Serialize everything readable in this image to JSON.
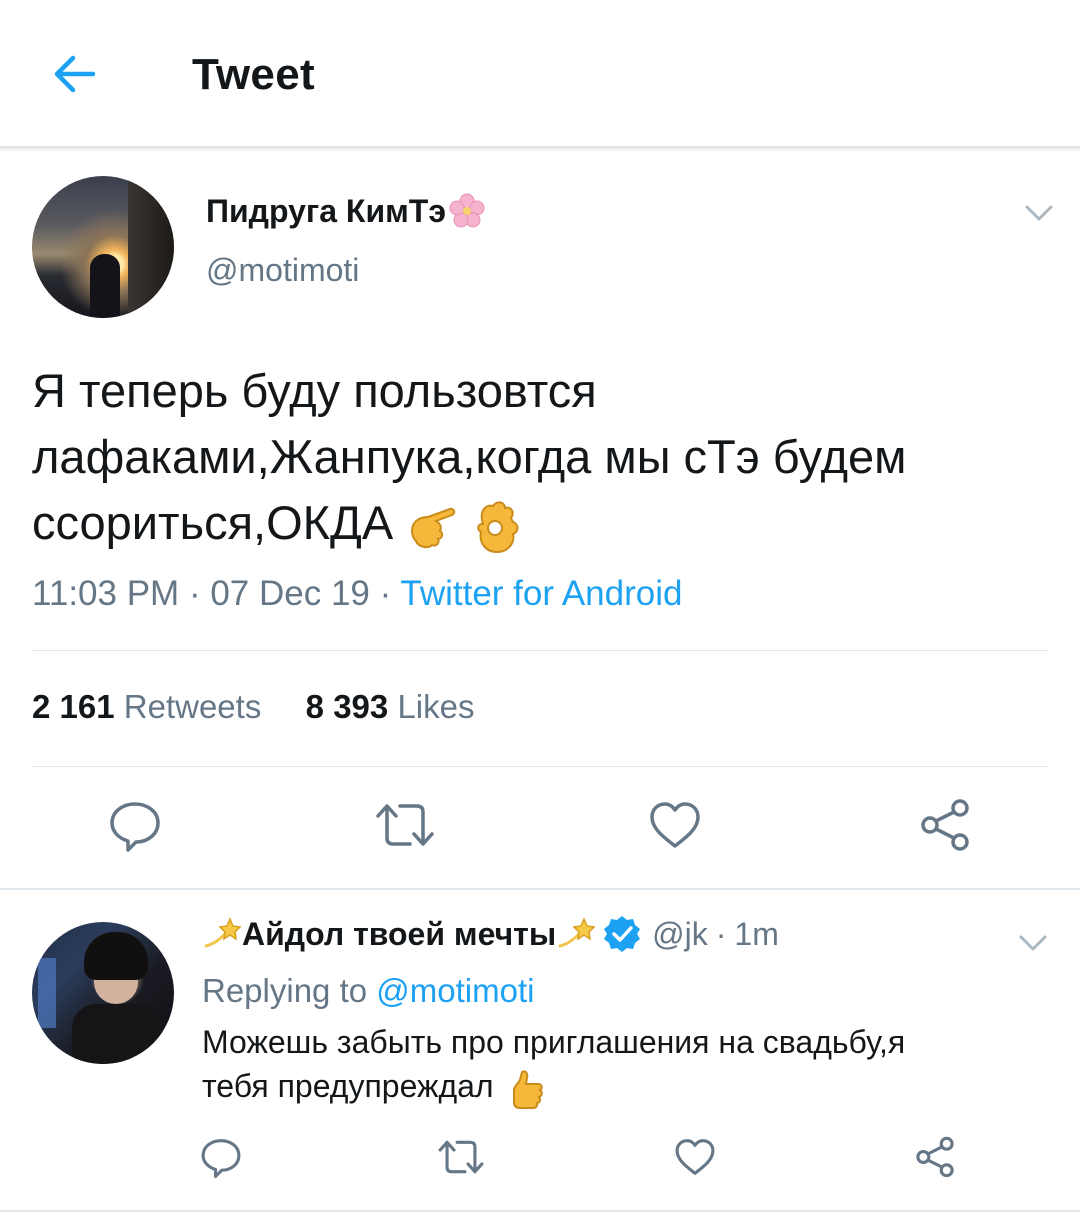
{
  "header": {
    "title": "Tweet",
    "back_icon": "arrow-left-icon",
    "accent": "#1da1f2"
  },
  "tweet": {
    "author_name": "Пидруга КимТэ",
    "author_handle": "@motimoti",
    "author_emoji": "cherry-blossom-icon",
    "text_lines": [
      "Я теперь буду пользовтся",
      "лафаками,Жанпука,когда мы сТэ будем",
      "ссориться,ОКДА"
    ],
    "text_emojis": [
      "pointing-hand-icon",
      "ok-hand-icon"
    ],
    "time": "11:03 PM",
    "date": "07 Dec 19",
    "separator": "·",
    "source": "Twitter for Android",
    "retweets_count": "2 161",
    "retweets_label": "Retweets",
    "likes_count": "8 393",
    "likes_label": "Likes",
    "actions": [
      "reply-icon",
      "retweet-icon",
      "like-icon",
      "share-icon"
    ]
  },
  "reply": {
    "author_name": "Айдол твоей мечты",
    "name_emoji": "dizzy-star-icon",
    "verified_icon": "verified-badge-icon",
    "handle": "@jk",
    "separator": "·",
    "time": "1m",
    "replying_prefix": "Replying to",
    "replying_handle": "@motimoti",
    "text_line1": "Можешь забыть про приглашения на свадьбу,я",
    "text_line2": "тебя предупреждал",
    "text_emoji": "thumbs-up-icon",
    "actions": [
      "reply-icon",
      "retweet-icon",
      "like-icon",
      "share-icon"
    ]
  }
}
